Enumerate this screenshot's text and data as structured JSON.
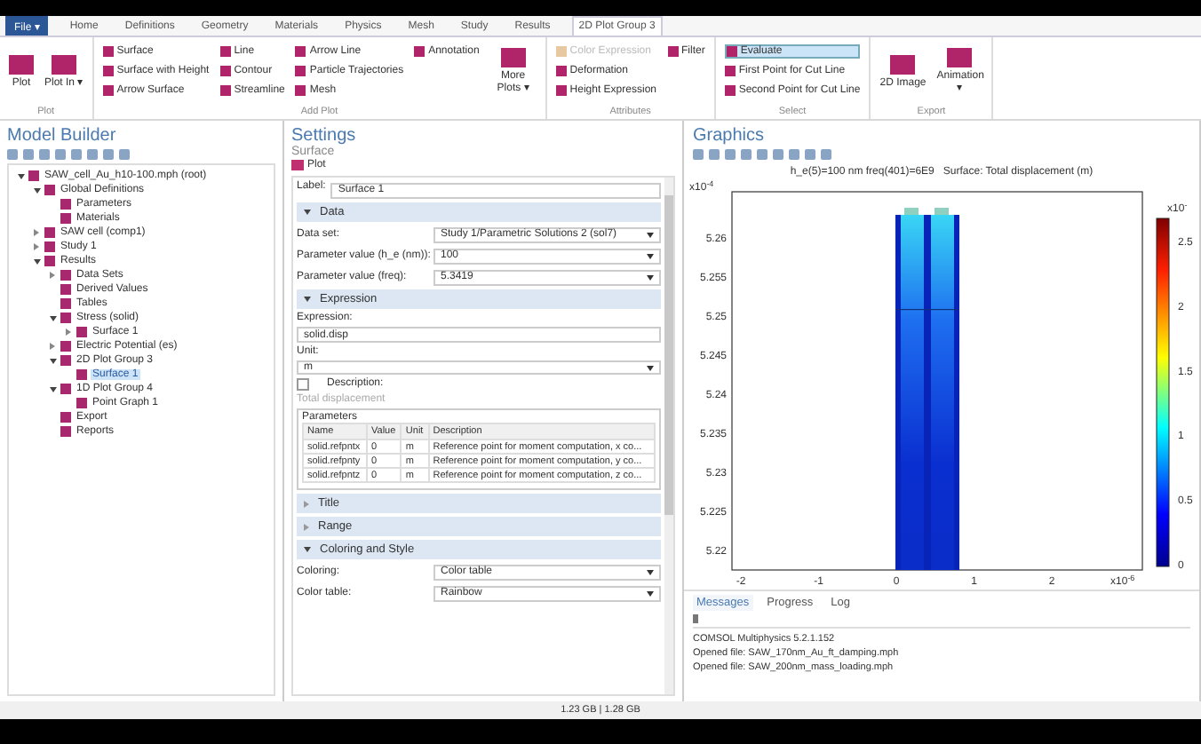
{
  "ribbon": {
    "tabs": [
      {
        "label": "File ▾",
        "selected": false,
        "kind": "file"
      },
      {
        "label": "Home",
        "selected": false
      },
      {
        "label": "Definitions",
        "selected": false
      },
      {
        "label": "Geometry",
        "selected": false
      },
      {
        "label": "Materials",
        "selected": false
      },
      {
        "label": "Physics",
        "selected": false
      },
      {
        "label": "Mesh",
        "selected": false
      },
      {
        "label": "Study",
        "selected": false
      },
      {
        "label": "Results",
        "selected": false
      },
      {
        "label": "2D Plot Group 3",
        "selected": true
      }
    ],
    "groups": [
      {
        "label": "Plot",
        "items": [
          {
            "label": "Plot",
            "kind": "large"
          },
          {
            "label": "Plot In ▾",
            "kind": "large"
          }
        ]
      },
      {
        "label": "Add Plot",
        "items": [
          {
            "label": "Surface",
            "kind": "small"
          },
          {
            "label": "Surface with Height",
            "kind": "small"
          },
          {
            "label": "Arrow Surface",
            "kind": "small"
          },
          {
            "label": "Line",
            "kind": "small"
          },
          {
            "label": "Contour",
            "kind": "small"
          },
          {
            "label": "Streamline",
            "kind": "small"
          },
          {
            "label": "Arrow Line",
            "kind": "small"
          },
          {
            "label": "Particle Trajectories",
            "kind": "small"
          },
          {
            "label": "Mesh",
            "kind": "small"
          },
          {
            "label": "Annotation",
            "kind": "small"
          },
          {
            "label": "More Plots ▾",
            "kind": "large"
          }
        ]
      },
      {
        "label": "Attributes",
        "items": [
          {
            "label": "Color Expression",
            "kind": "small",
            "disabled": true
          },
          {
            "label": "Deformation",
            "kind": "small"
          },
          {
            "label": "Height Expression",
            "kind": "small"
          },
          {
            "label": "Filter",
            "kind": "small"
          }
        ]
      },
      {
        "label": "Select",
        "items": [
          {
            "label": "Evaluate",
            "kind": "small",
            "active": true
          },
          {
            "label": "First Point for Cut Line",
            "kind": "small"
          },
          {
            "label": "Second Point for Cut Line",
            "kind": "small"
          }
        ]
      },
      {
        "label": "Export",
        "items": [
          {
            "label": "2D Image",
            "kind": "large"
          },
          {
            "label": "Animation ▾",
            "kind": "large"
          }
        ]
      }
    ]
  },
  "model_builder": {
    "title": "Model Builder",
    "tree": [
      {
        "label": "SAW_cell_Au_h10-100.mph (root)",
        "expanded": true,
        "selected": false,
        "children": [
          {
            "label": "Global Definitions",
            "expanded": true,
            "selected": false,
            "children": [
              {
                "label": "Parameters",
                "selected": false
              },
              {
                "label": "Materials",
                "selected": false
              }
            ]
          },
          {
            "label": "SAW cell (comp1)",
            "expanded": false,
            "selected": false
          },
          {
            "label": "Study 1",
            "expanded": false,
            "selected": false
          },
          {
            "label": "Results",
            "expanded": true,
            "selected": false,
            "children": [
              {
                "label": "Data Sets",
                "expanded": false,
                "selected": false
              },
              {
                "label": "Derived Values",
                "selected": false
              },
              {
                "label": "Tables",
                "selected": false
              },
              {
                "label": "Stress (solid)",
                "expanded": true,
                "selected": false,
                "children": [
                  {
                    "label": "Surface 1",
                    "expanded": false,
                    "selected": false
                  }
                ]
              },
              {
                "label": "Electric Potential (es)",
                "expanded": false,
                "selected": false
              },
              {
                "label": "2D Plot Group 3",
                "expanded": true,
                "selected": false,
                "children": [
                  {
                    "label": "Surface 1",
                    "selected": true
                  }
                ]
              },
              {
                "label": "1D Plot Group 4",
                "expanded": true,
                "selected": false,
                "children": [
                  {
                    "label": "Point Graph 1",
                    "selected": false
                  }
                ]
              },
              {
                "label": "Export",
                "selected": false
              },
              {
                "label": "Reports",
                "selected": false
              }
            ]
          }
        ]
      }
    ]
  },
  "settings": {
    "title": "Settings",
    "subtitle": "Surface",
    "plot_button": "Plot",
    "label": {
      "label": "Label:",
      "value": "Surface 1"
    },
    "sections": [
      {
        "title": "Data",
        "expanded": true,
        "kind": "rows",
        "rows": [
          {
            "label": "Data set:",
            "value": "Study 1/Parametric Solutions 2 (sol7)"
          },
          {
            "label": "Parameter value (h_e (nm)):",
            "value": "100"
          },
          {
            "label": "Parameter value (freq):",
            "value": "5.3419"
          }
        ]
      },
      {
        "title": "Expression",
        "expanded": true,
        "kind": "expression",
        "expression_label": "Expression:",
        "expression": "solid.disp",
        "unit_label": "Unit:",
        "unit": "m",
        "description_label": "Description:",
        "description_checked": false,
        "description": "Total displacement",
        "parameters": {
          "title": "Parameters",
          "columns": [
            "Name",
            "Value",
            "Unit",
            "Description"
          ],
          "rows": [
            [
              "solid.refpntx",
              "0",
              "m",
              "Reference point for moment computation, x co..."
            ],
            [
              "solid.refpnty",
              "0",
              "m",
              "Reference point for moment computation, y co..."
            ],
            [
              "solid.refpntz",
              "0",
              "m",
              "Reference point for moment computation, z co..."
            ]
          ]
        }
      },
      {
        "title": "Title",
        "expanded": false
      },
      {
        "title": "Range",
        "expanded": false
      },
      {
        "title": "Coloring and Style",
        "expanded": true,
        "kind": "rows",
        "rows": [
          {
            "label": "Coloring:",
            "value": "Color table"
          },
          {
            "label": "Color table:",
            "value": "Rainbow"
          }
        ]
      }
    ]
  },
  "graphics": {
    "title": "Graphics",
    "plot_title": "h_e(5)=100 nm freq(401)=6E9   Surface: Total displacement (m)",
    "y_exponent": {
      "base": "x10",
      "power": "-4"
    },
    "y_ticks": [
      "5.26",
      "5.255",
      "5.25",
      "5.245",
      "5.24",
      "5.235",
      "5.23",
      "5.225",
      "5.22"
    ],
    "x_exponent": {
      "base": "x10",
      "power": "-6"
    },
    "x_ticks": [
      "-2",
      "-1",
      "0",
      "1",
      "2"
    ],
    "colorbar": {
      "exponent": {
        "base": "x10",
        "power": "-"
      },
      "ticks": [
        "2.5",
        "2",
        "1.5",
        "1",
        "0.5",
        "0"
      ]
    }
  },
  "messages": {
    "tabs": [
      {
        "label": "Messages",
        "selected": true
      },
      {
        "label": "Progress",
        "selected": false
      },
      {
        "label": "Log",
        "selected": false
      }
    ],
    "lines": [
      "COMSOL Multiphysics 5.2.1.152",
      "Opened file: SAW_170nm_Au_ft_damping.mph",
      "Opened file: SAW_200nm_mass_loading.mph"
    ]
  },
  "status_bar": "1.23 GB | 1.28 GB"
}
